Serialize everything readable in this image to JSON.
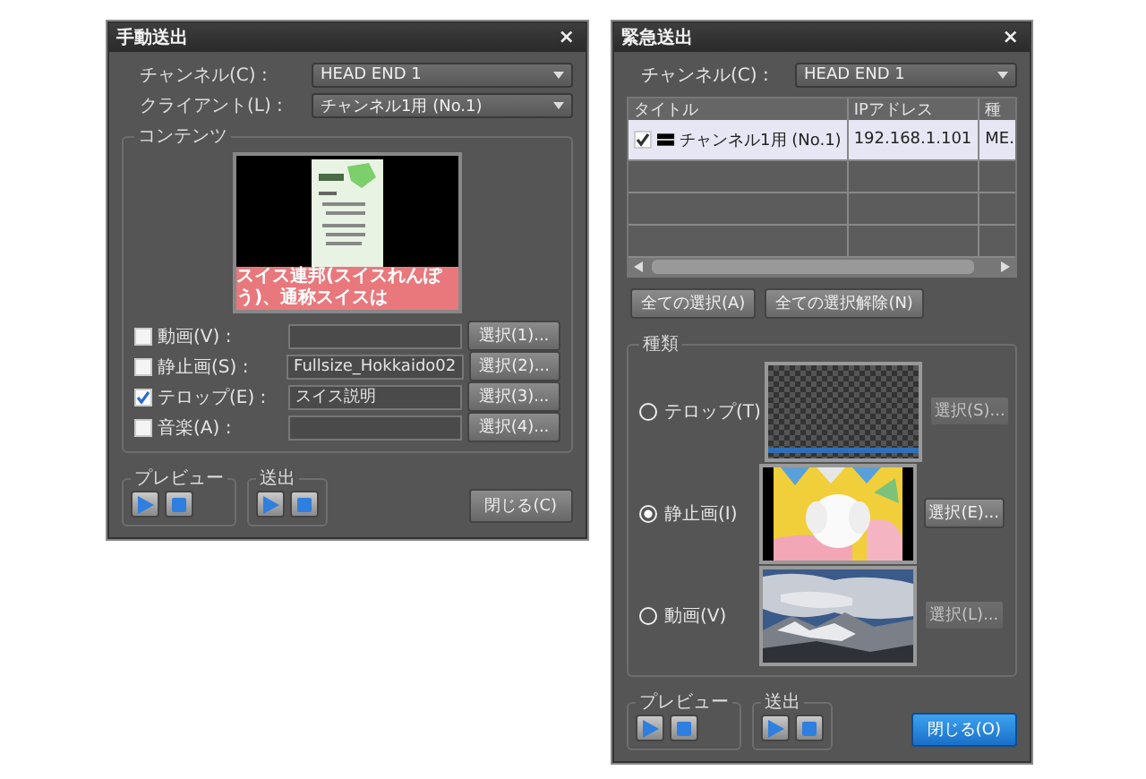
{
  "manual_dialog": {
    "title": "手動送出",
    "close": "×",
    "fields": [
      {
        "label": "チャンネル(C) :",
        "value": "HEAD END 1"
      },
      {
        "label": "クライアント(L) :",
        "value": "チャンネル1用 (No.1)"
      }
    ],
    "contents": {
      "title": "コンテンツ",
      "telop_text": "スイス連邦(スイスれんぽう)、通称スイスは",
      "rows": [
        {
          "label": "動画(V) :",
          "checked": false,
          "button": "選択(1)..."
        },
        {
          "label": "静止画(S) :",
          "checked": false,
          "value": "Fullsize_Hokkaido02",
          "button": "選択(2)..."
        },
        {
          "label": "テロップ(E) :",
          "checked": true,
          "value": "スイス説明",
          "button": "選択(3)..."
        },
        {
          "label": "音楽(A) :",
          "checked": false,
          "button": "選択(4)..."
        }
      ]
    },
    "preview_group": "プレビュー",
    "send_group": "送出",
    "close_button": "閉じる(C)"
  },
  "emergency_dialog": {
    "title": "緊急送出",
    "close": "×",
    "channel": {
      "label": "チャンネル(C) :",
      "value": "HEAD END 1"
    },
    "table": {
      "columns": [
        "タイトル",
        "IPアドレス",
        "種"
      ],
      "rows": [
        {
          "checked": true,
          "title": "チャンネル1用 (No.1)",
          "ip": "192.168.1.101",
          "column_3": "ME."
        }
      ]
    },
    "select_all": "全ての選択(A)",
    "deselect_all": "全ての選択解除(N)",
    "type_group": {
      "title": "種類",
      "options": [
        {
          "kind": "telop",
          "label": "テロップ(T)",
          "selected": false,
          "button": "選択(S)...",
          "disabled": true
        },
        {
          "kind": "still",
          "label": "静止画(I)",
          "selected": true,
          "button": "選択(E)...",
          "disabled": false
        },
        {
          "kind": "video",
          "label": "動画(V)",
          "selected": false,
          "button": "選択(L)...",
          "disabled": true
        }
      ]
    },
    "preview_group": "プレビュー",
    "send_group": "送出",
    "close_button": "閉じる(O)"
  }
}
